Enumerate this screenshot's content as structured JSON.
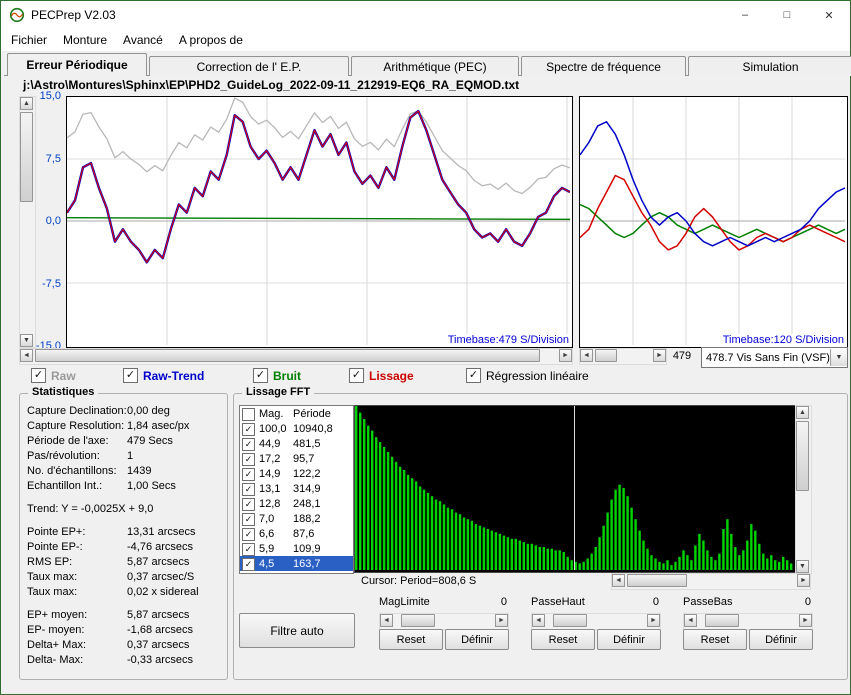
{
  "window": {
    "title": "PECPrep V2.03"
  },
  "icons": {
    "minimize": "–",
    "maximize": "□",
    "close": "✕",
    "check": "✓",
    "up": "▲",
    "down": "▼",
    "left": "◄",
    "right": "►",
    "dropdown": "▼"
  },
  "menu": {
    "items": [
      "Fichier",
      "Monture",
      "Avancé",
      "A propos de"
    ]
  },
  "tabs": {
    "items": [
      {
        "label": "Erreur Périodique",
        "active": true
      },
      {
        "label": "Correction de l' E.P.",
        "active": false
      },
      {
        "label": "Arithmétique (PEC)",
        "active": false
      },
      {
        "label": "Spectre de fréquence",
        "active": false
      },
      {
        "label": "Simulation",
        "active": false
      }
    ]
  },
  "file_path": "j:\\Astro\\Montures\\Sphinx\\EP\\PHD2_GuideLog_2022-09-11_212919-EQ6_RA_EQMOD.txt",
  "axis_combo": {
    "scroll_value": "479",
    "selected": "478.7 Vis Sans Fin (VSF)"
  },
  "series_toggles": [
    {
      "label": "Raw",
      "color": "#9a9a9a",
      "checked": true,
      "bold": true
    },
    {
      "label": "Raw-Trend",
      "color": "#0000cc",
      "checked": true,
      "bold": true
    },
    {
      "label": "Bruit",
      "color": "#008000",
      "checked": true,
      "bold": true
    },
    {
      "label": "Lissage",
      "color": "#cc0000",
      "checked": true,
      "bold": true
    },
    {
      "label": "Régression linéaire",
      "color": "#000000",
      "checked": true,
      "bold": false
    }
  ],
  "statistics": {
    "title": "Statistiques",
    "rows1": [
      {
        "label": "Capture Declination:",
        "value": "0,00 deg"
      },
      {
        "label": "Capture Resolution:",
        "value": "1,84 asec/px"
      },
      {
        "label": "Période de l'axe:",
        "value": "479 Secs"
      },
      {
        "label": "Pas/révolution:",
        "value": "1"
      },
      {
        "label": "No. d'échantillons:",
        "value": "1439"
      },
      {
        "label": "Echantillon Int.:",
        "value": "1,00 Secs"
      }
    ],
    "trend": "Trend: Y = -0,0025X + 9,0",
    "rows2": [
      {
        "label": "Pointe EP+:",
        "value": "13,31 arcsecs"
      },
      {
        "label": "Pointe EP-:",
        "value": "-4,76 arcsecs"
      },
      {
        "label": "RMS EP:",
        "value": "5,87 arcsecs"
      },
      {
        "label": "Taux max:",
        "value": "0,37 arcsec/S"
      },
      {
        "label": "Taux max:",
        "value": "0,02 x sidereal"
      }
    ],
    "rows3": [
      {
        "label": "EP+ moyen:",
        "value": "5,87 arcsecs"
      },
      {
        "label": "EP- moyen:",
        "value": "-1,68 arcsecs"
      },
      {
        "label": "Delta+ Max:",
        "value": "0,37 arcsecs"
      },
      {
        "label": "Delta- Max:",
        "value": "-0,33 arcsecs"
      }
    ]
  },
  "fft": {
    "title": "Lissage FFT",
    "list_header": {
      "mag": "Mag.",
      "period": "Période"
    },
    "rows": [
      {
        "mag": "100,0",
        "period": "10940,8",
        "checked": true,
        "selected": false
      },
      {
        "mag": "44,9",
        "period": "481,5",
        "checked": true,
        "selected": false
      },
      {
        "mag": "17,2",
        "period": "95,7",
        "checked": true,
        "selected": false
      },
      {
        "mag": "14,9",
        "period": "122,2",
        "checked": true,
        "selected": false
      },
      {
        "mag": "13,1",
        "period": "314,9",
        "checked": true,
        "selected": false
      },
      {
        "mag": "12,8",
        "period": "248,1",
        "checked": true,
        "selected": false
      },
      {
        "mag": "7,0",
        "period": "188,2",
        "checked": true,
        "selected": false
      },
      {
        "mag": "6,6",
        "period": "87,6",
        "checked": true,
        "selected": false
      },
      {
        "mag": "5,9",
        "period": "109,9",
        "checked": true,
        "selected": false
      },
      {
        "mag": "4,5",
        "period": "163,7",
        "checked": true,
        "selected": true
      }
    ],
    "cursor_label": "Cursor: Period=808,6 S",
    "filter_button": "Filtre auto",
    "sliders": [
      {
        "label": "MagLimite",
        "value": "0",
        "reset": "Reset",
        "define": "Définir"
      },
      {
        "label": "PasseHaut",
        "value": "0",
        "reset": "Reset",
        "define": "Définir"
      },
      {
        "label": "PasseBas",
        "value": "0",
        "reset": "Reset",
        "define": "Définir"
      }
    ]
  },
  "chart_data": {
    "main": {
      "type": "line",
      "ylim": [
        -15,
        15
      ],
      "yticks": [
        "15,0",
        "7,5",
        "0,0",
        "-7,5",
        "-15,0"
      ],
      "timebase": "Timebase:479 S/Division",
      "blue": [
        1,
        2.5,
        6.5,
        7,
        4,
        1.5,
        -2.5,
        -1,
        -2.5,
        -3.5,
        -5,
        -3.5,
        -4.5,
        -1,
        2,
        1,
        4,
        3,
        6,
        5,
        8,
        12.8,
        12,
        9,
        7.5,
        8.5,
        7,
        5,
        6.5,
        5,
        8,
        11,
        9,
        10.5,
        8,
        9.5,
        6,
        4.5,
        5.5,
        4,
        6.5,
        5,
        9,
        12.5,
        13.3,
        11,
        8,
        5,
        3.5,
        2,
        1,
        -1,
        -2,
        -1.5,
        -2.5,
        -1,
        -2.5,
        -3,
        -1.5,
        0.5,
        1,
        3,
        4,
        3.5
      ],
      "gray_transform": {
        "scale": 0.55,
        "offset_start": 9.5,
        "offset_end": 4.5
      },
      "green_line": [
        0.4,
        0.2
      ]
    },
    "right": {
      "type": "line",
      "ylim": [
        -15,
        15
      ],
      "timebase": "Timebase:120 S/Division",
      "blue": [
        8,
        9.5,
        11.5,
        12,
        10.5,
        8,
        5,
        2.5,
        0.5,
        -0.5,
        0.5,
        1,
        0,
        -1.5,
        -2.5,
        -3,
        -2.5,
        -2,
        -2.5,
        -3,
        -2.5,
        -2,
        -2.5,
        -2,
        -1.5,
        -1,
        0,
        1.5,
        2.5,
        3.5,
        4
      ],
      "red": [
        -2,
        -1,
        1.5,
        3.5,
        5.5,
        5,
        3,
        1,
        -0.5,
        -2.5,
        -3.5,
        -3,
        -1.5,
        0.5,
        1.5,
        0.5,
        -1,
        -2.5,
        -3.5,
        -3,
        -2,
        -1.5,
        -2,
        -2.5,
        -2,
        -1,
        -0.5,
        -1,
        -1.5,
        -2,
        -2.5
      ],
      "green": [
        2,
        1.5,
        0.5,
        -0.5,
        -1.5,
        -2,
        -1.5,
        -0.5,
        0.5,
        1,
        0.5,
        -0.5,
        -1,
        -1.5,
        -1,
        -0.5,
        -1,
        -1.5,
        -2,
        -1.5,
        -1,
        -1.5,
        -2,
        -2.5,
        -2,
        -1.5,
        -1,
        -0.5,
        -1,
        -1.5,
        -1
      ]
    },
    "fft_spectrum": {
      "type": "bar",
      "cursor_frac": 0.5,
      "bars_pct": [
        100,
        96,
        92,
        88,
        85,
        81,
        78,
        75,
        72,
        69,
        66,
        63,
        61,
        58,
        56,
        54,
        51,
        49,
        47,
        45,
        43,
        42,
        40,
        38,
        37,
        35,
        34,
        32,
        31,
        30,
        28,
        27,
        26,
        25,
        24,
        23,
        22,
        21,
        20,
        19,
        19,
        18,
        17,
        16,
        16,
        15,
        14,
        14,
        13,
        13,
        12,
        12,
        11,
        8,
        6,
        5,
        4,
        5,
        7,
        10,
        14,
        20,
        27,
        35,
        43,
        49,
        52,
        50,
        45,
        38,
        31,
        24,
        18,
        13,
        9,
        7,
        5,
        4,
        6,
        3,
        5,
        8,
        12,
        9,
        6,
        15,
        22,
        18,
        12,
        8,
        6,
        10,
        25,
        31,
        22,
        14,
        9,
        12,
        18,
        28,
        24,
        16,
        10,
        7,
        9,
        6,
        5,
        8,
        6,
        4
      ]
    }
  }
}
